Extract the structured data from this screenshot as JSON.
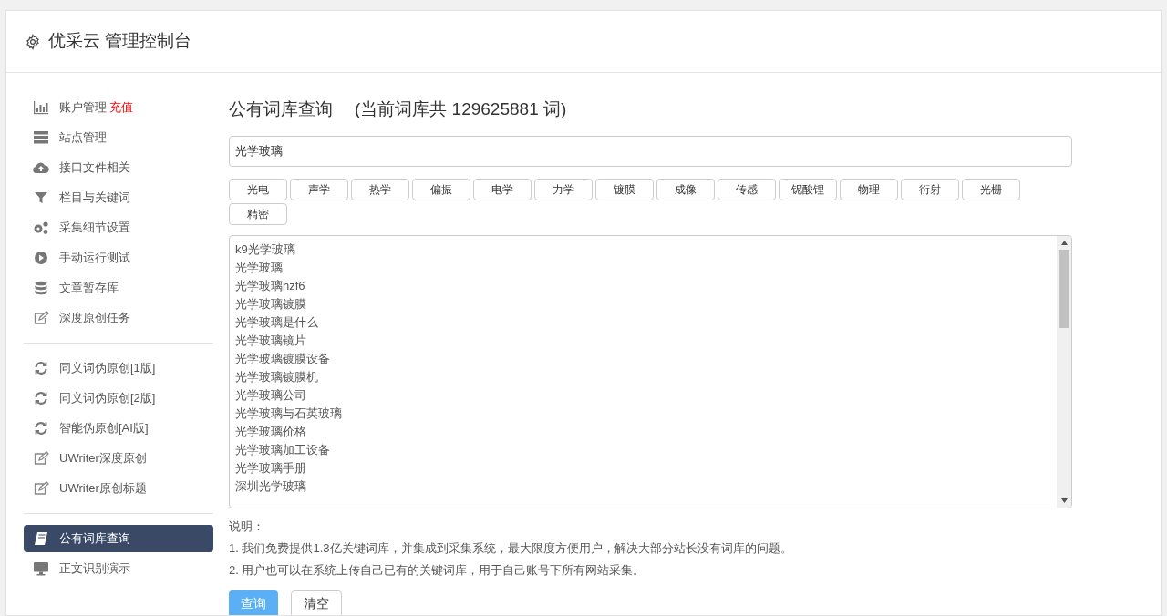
{
  "header": {
    "title": "优采云 管理控制台"
  },
  "sidebar": {
    "groups": [
      {
        "items": [
          {
            "label": "账户管理",
            "badge": "充值",
            "kind": "chart",
            "selected": false
          },
          {
            "label": "站点管理",
            "kind": "server",
            "selected": false
          },
          {
            "label": "接口文件相关",
            "kind": "cloud",
            "selected": false
          },
          {
            "label": "栏目与关键词",
            "kind": "filter",
            "selected": false
          },
          {
            "label": "采集细节设置",
            "kind": "gears",
            "selected": false
          },
          {
            "label": "手动运行测试",
            "kind": "play",
            "selected": false
          },
          {
            "label": "文章暂存库",
            "kind": "database",
            "selected": false
          },
          {
            "label": "深度原创任务",
            "kind": "edit",
            "selected": false
          }
        ]
      },
      {
        "items": [
          {
            "label": "同义词伪原创[1版]",
            "kind": "refresh",
            "selected": false
          },
          {
            "label": "同义词伪原创[2版]",
            "kind": "refresh",
            "selected": false
          },
          {
            "label": "智能伪原创[AI版]",
            "kind": "refresh",
            "selected": false
          },
          {
            "label": "UWriter深度原创",
            "kind": "edit",
            "selected": false
          },
          {
            "label": "UWriter原创标题",
            "kind": "edit",
            "selected": false
          }
        ]
      },
      {
        "items": [
          {
            "label": "公有词库查询",
            "kind": "book",
            "selected": true
          },
          {
            "label": "正文识别演示",
            "kind": "monitor",
            "selected": false
          }
        ]
      }
    ]
  },
  "main": {
    "heading": "公有词库查询",
    "count_note": "(当前词库共 129625881 词)",
    "search": {
      "value": "光学玻璃"
    },
    "tags": [
      "光电",
      "声学",
      "热学",
      "偏振",
      "电学",
      "力学",
      "镀膜",
      "成像",
      "传感",
      "铌酸锂",
      "物理",
      "衍射",
      "光栅",
      "精密"
    ],
    "results": [
      "k9光学玻璃",
      "光学玻璃",
      "光学玻璃hzf6",
      "光学玻璃镀膜",
      "光学玻璃是什么",
      "光学玻璃镜片",
      "光学玻璃镀膜设备",
      "光学玻璃镀膜机",
      "光学玻璃公司",
      "光学玻璃与石英玻璃",
      "光学玻璃价格",
      "光学玻璃加工设备",
      "光学玻璃手册",
      "深圳光学玻璃"
    ],
    "notes_title": "说明：",
    "notes": [
      "1. 我们免费提供1.3亿关键词库，并集成到采集系统，最大限度方便用户，解决大部分站长没有词库的问题。",
      "2. 用户也可以在系统上传自己已有的关键词库，用于自己账号下所有网站采集。"
    ],
    "buttons": [
      {
        "label": "查询",
        "kind": "primary"
      },
      {
        "label": "清空",
        "kind": "default"
      }
    ]
  }
}
